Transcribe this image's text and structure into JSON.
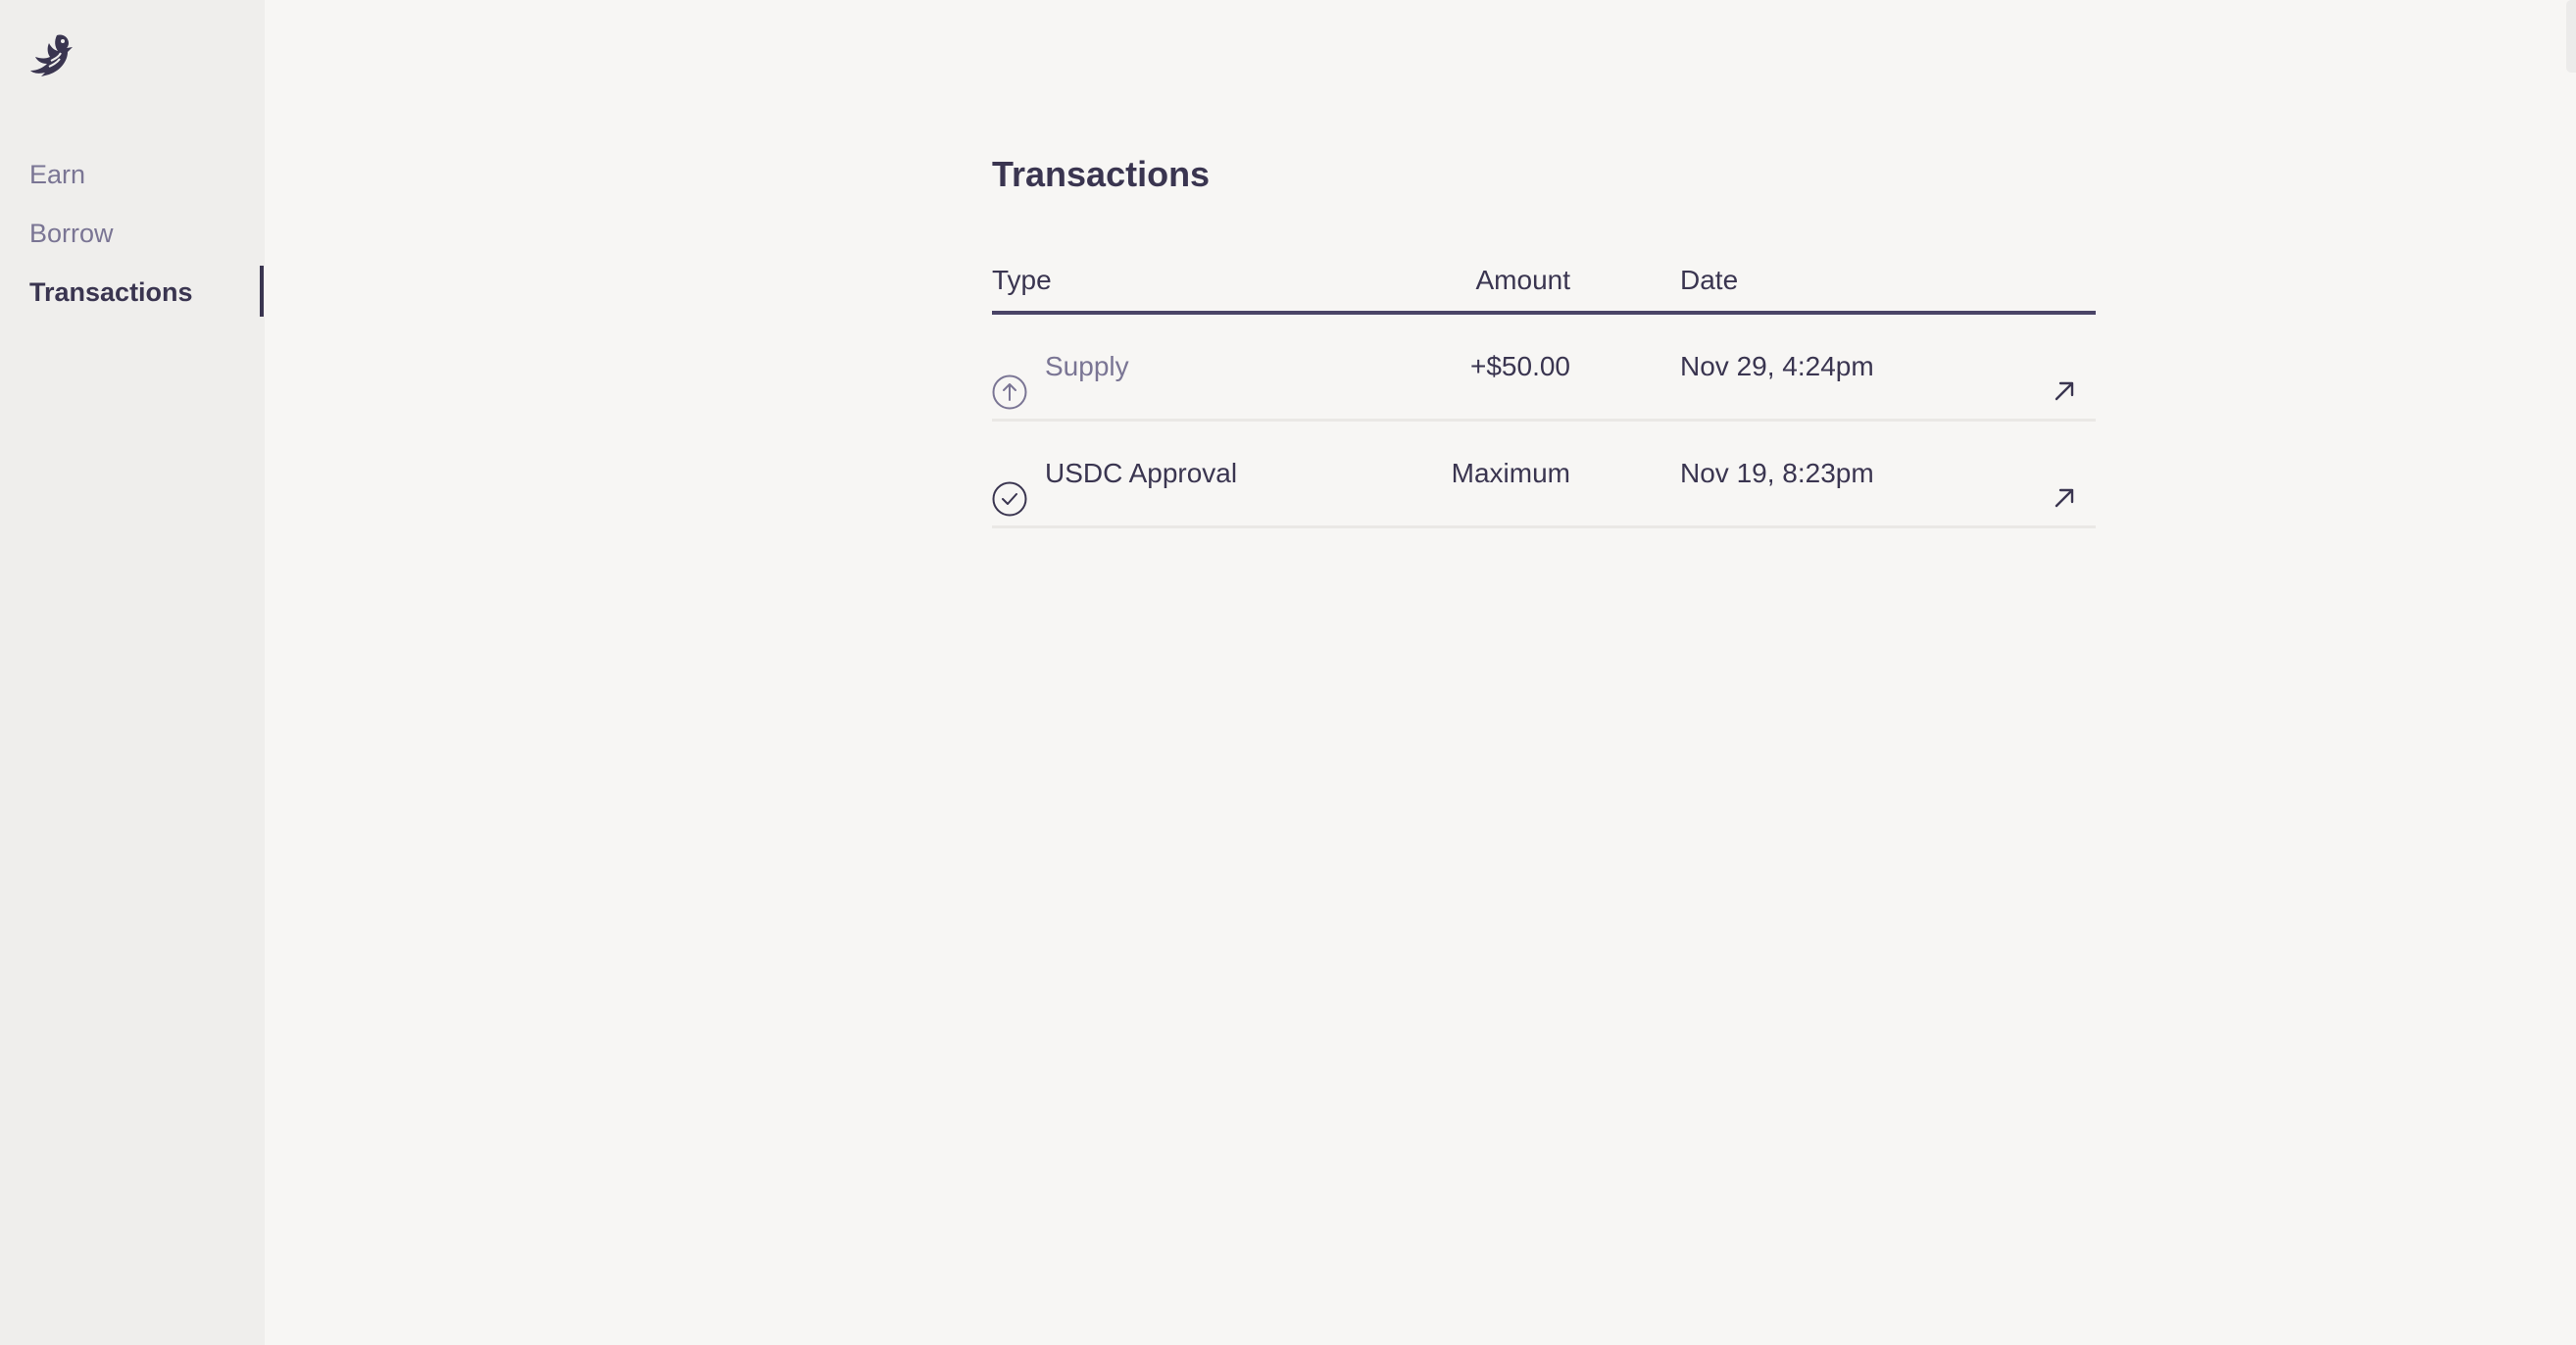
{
  "sidebar": {
    "logo_icon": "bird-logo-icon",
    "items": [
      {
        "label": "Earn",
        "active": false
      },
      {
        "label": "Borrow",
        "active": false
      },
      {
        "label": "Transactions",
        "active": true
      }
    ]
  },
  "main": {
    "title": "Transactions",
    "table": {
      "columns": [
        "Type",
        "Amount",
        "Date"
      ],
      "rows": [
        {
          "icon": "arrow-up-circle-icon",
          "type": "Supply",
          "amount": "+$50.00",
          "date": "Nov 29, 4:24pm",
          "link_icon": "external-link-arrow-icon"
        },
        {
          "icon": "check-circle-icon",
          "type": "USDC Approval",
          "amount": "Maximum",
          "date": "Nov 19, 8:23pm",
          "link_icon": "external-link-arrow-icon"
        }
      ]
    }
  },
  "colors": {
    "text_primary": "#3a3550",
    "text_muted": "#7a7594",
    "background": "#f7f6f4",
    "sidebar_background": "#efeeec"
  }
}
